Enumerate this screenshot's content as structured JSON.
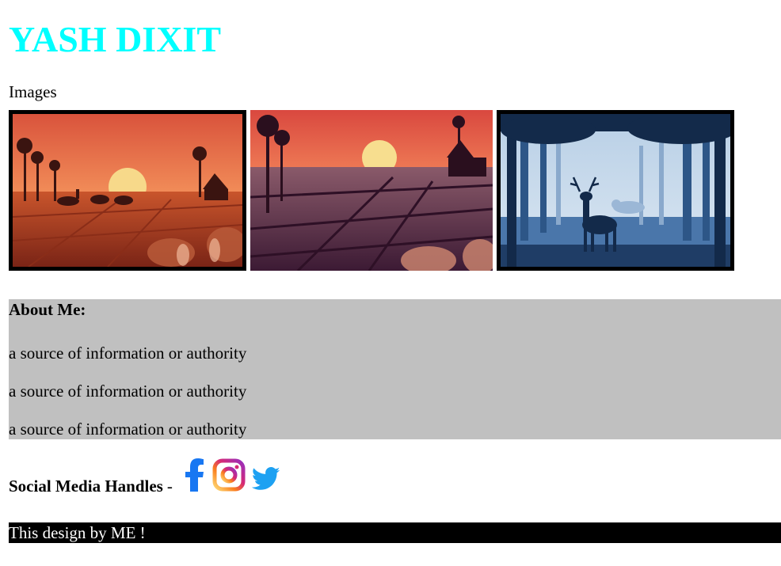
{
  "header": {
    "title": "YASH DIXIT"
  },
  "images_label": "Images",
  "gallery": {
    "images": [
      {
        "icon": "sunset-farm-illustration"
      },
      {
        "icon": "sunset-fields-illustration"
      },
      {
        "icon": "deer-forest-illustration"
      }
    ]
  },
  "about": {
    "heading": "About Me:",
    "lines": [
      "a source of information or authority",
      "a source of information or authority",
      "a source of information or authority"
    ]
  },
  "social": {
    "label": "Social Media Handles",
    "dash": "-",
    "icons": [
      "facebook-icon",
      "instagram-icon",
      "twitter-icon"
    ]
  },
  "footer": {
    "text": "This design by ME !"
  },
  "colors": {
    "title": "#00ffff",
    "about_bg": "#c0c0c0",
    "footer_bg": "#000000",
    "facebook": "#1877f2",
    "twitter": "#1da1f2"
  }
}
